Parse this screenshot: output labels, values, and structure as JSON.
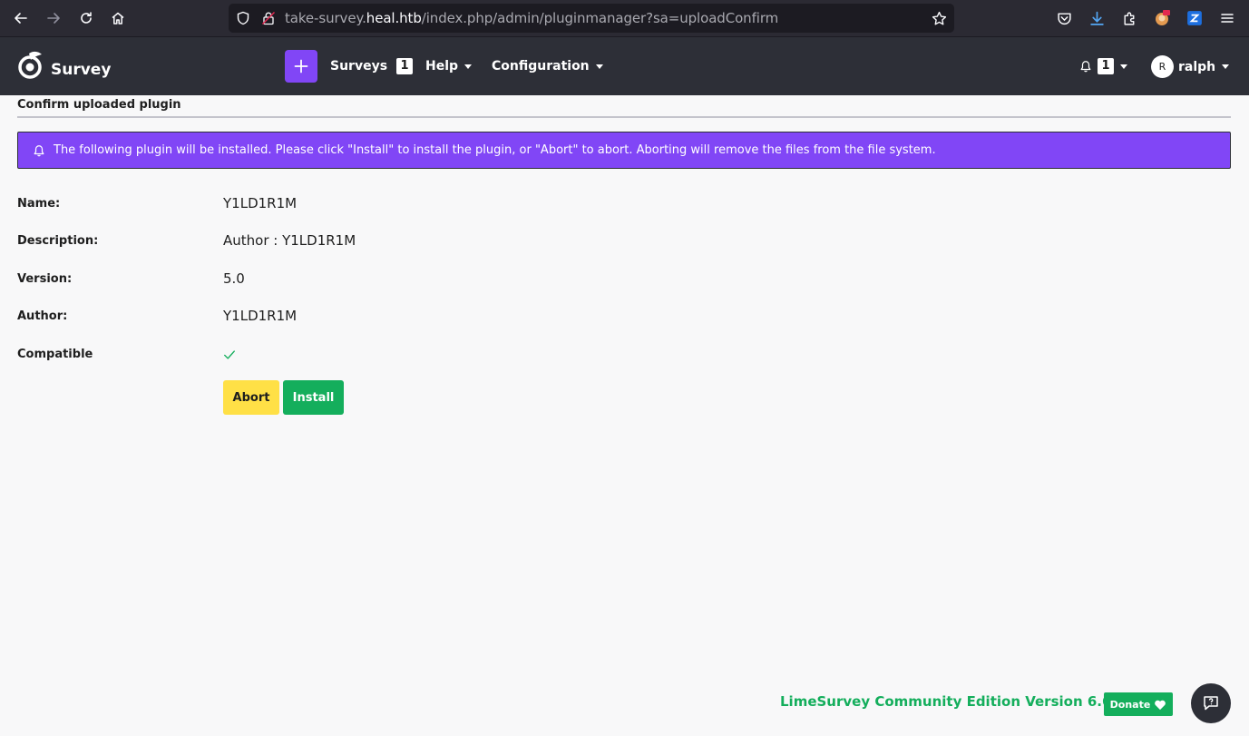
{
  "browser": {
    "url_prefix": "take-survey.",
    "url_host": "heal.htb",
    "url_path": "/index.php/admin/pluginmanager?sa=uploadConfirm",
    "icons": [
      "back-icon",
      "forward-icon",
      "reload-icon",
      "home-icon",
      "shield-icon",
      "insecure-lock-icon",
      "bookmark-star-icon",
      "pocket-icon",
      "download-icon",
      "extensions-icon",
      "profile-icon",
      "container-icon",
      "menu-icon"
    ]
  },
  "navbar": {
    "logo_text": "Survey",
    "create_icon": "plus-icon",
    "items": [
      {
        "label": "Surveys",
        "badge": "1"
      },
      {
        "label": "Help"
      },
      {
        "label": "Configuration"
      }
    ],
    "notifications_count": "1",
    "user_initial": "R",
    "user_name": "ralph"
  },
  "page": {
    "title": "Confirm uploaded plugin",
    "alert": "The following plugin will be installed. Please click \"Install\" to install the plugin, or \"Abort\" to abort. Aborting will remove the files from the file system.",
    "fields": [
      {
        "label": "Name:",
        "value": "Y1LD1R1M"
      },
      {
        "label": "Description:",
        "value": "Author : Y1LD1R1M"
      },
      {
        "label": "Version:",
        "value": "5.0"
      },
      {
        "label": "Author:",
        "value": "Y1LD1R1M"
      },
      {
        "label": "Compatible",
        "value": ""
      }
    ],
    "abort_label": "Abort",
    "install_label": "Install"
  },
  "footer": {
    "version_text": "LimeSurvey Community Edition Version 6.6.4",
    "donate_label": "Donate"
  },
  "colors": {
    "accent": "#8146f6",
    "success": "#14ae5c",
    "warning": "#ffe046",
    "navbar": "#2d2f37"
  }
}
